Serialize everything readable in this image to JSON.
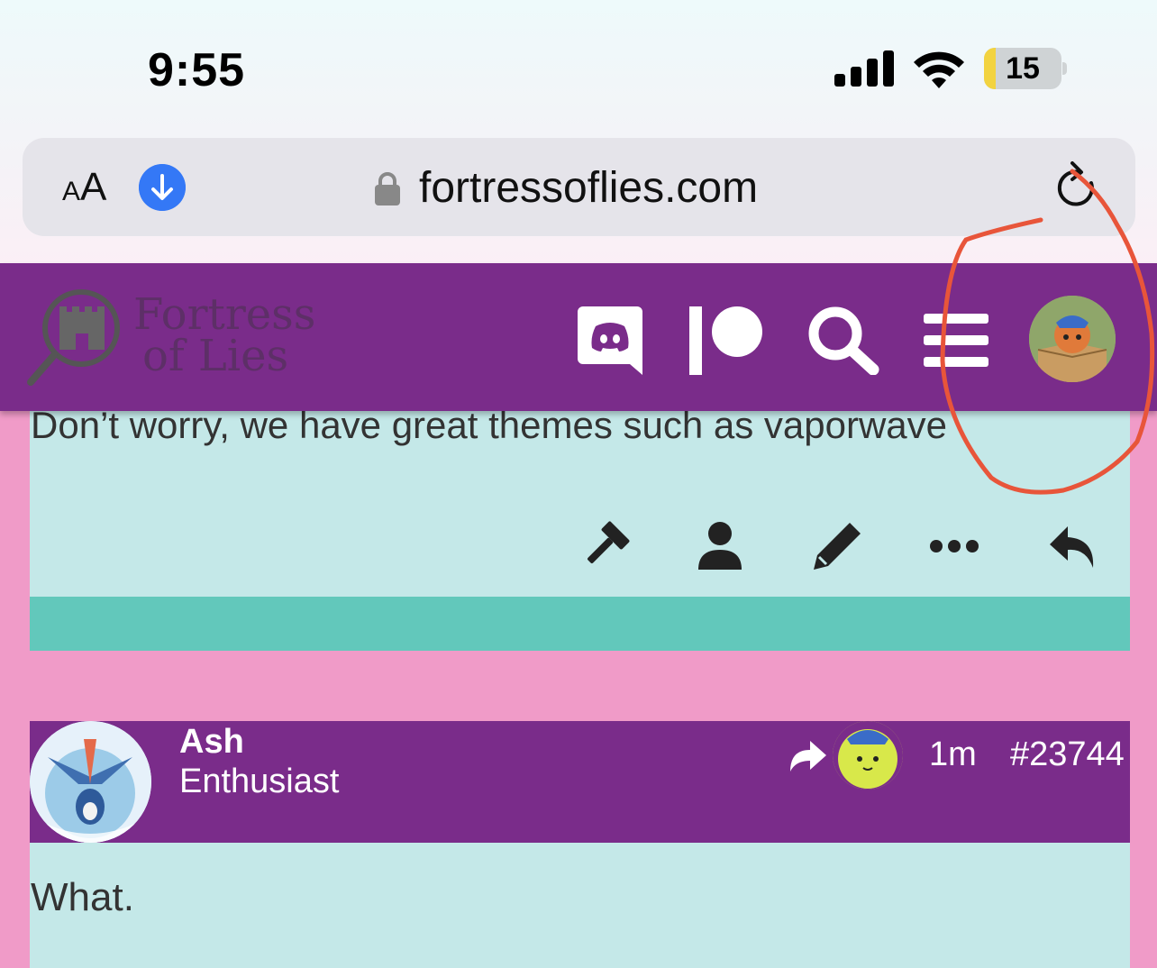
{
  "status_bar": {
    "time": "9:55",
    "battery_percent": "15",
    "battery_level": 0.15
  },
  "browser": {
    "text_size_label_small": "A",
    "text_size_label_large": "A",
    "url": "fortressoflies.com"
  },
  "site_header": {
    "logo_line1": "Fortress",
    "logo_line2": "of Lies",
    "icons": [
      "discord-icon",
      "patreon-icon",
      "search-icon",
      "menu-icon",
      "user-avatar"
    ]
  },
  "post1": {
    "body": "Don’t worry, we have great themes such as vaporwave",
    "actions": [
      "gavel-icon",
      "user-icon",
      "pencil-icon",
      "ellipsis-icon",
      "reply-icon"
    ]
  },
  "post2": {
    "username": "Ash",
    "user_title": "Enthusiast",
    "time_ago": "1m",
    "post_number": "#23744",
    "body": "What."
  },
  "colors": {
    "page_bg": "#f09bc8",
    "header_purple": "#7a2c8a",
    "post_bg": "#c4e8e8",
    "post_footer": "#62c8bb",
    "annotation_red": "#e8553a"
  }
}
